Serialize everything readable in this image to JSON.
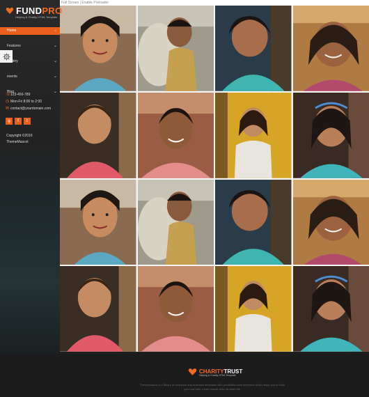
{
  "breadcrumb": "Full Screen | Enable Preloader",
  "brand": {
    "name_a": "FUND",
    "name_b": "PRO",
    "tagline": "Helping & Charity HTML Template"
  },
  "nav": [
    {
      "label": "Home",
      "has_sub": true
    },
    {
      "label": "Features",
      "has_sub": true
    },
    {
      "label": "Gallery",
      "has_sub": true
    },
    {
      "label": "events",
      "has_sub": true
    },
    {
      "label": "Blog",
      "has_sub": true
    }
  ],
  "contact": {
    "phone": "123-456-789",
    "hours": "Mon-Fri 8:00 to 2:00",
    "email": "contact@yourdomain.com"
  },
  "copyright": {
    "line1": "Copyright ©2016",
    "line2": "ThemeMascot"
  },
  "footer": {
    "brand_a": "CHARITY",
    "brand_b": "TRUST",
    "tagline": "Helping & Charity HTML Template",
    "text": "ThemeMascot is a library of corporate and business templates with predefined web elements which helps you to build your own site. Lorem ipsum dolor sit amet elit."
  },
  "colors": {
    "accent": "#e95f1b",
    "sidebar": "#232323",
    "footer": "#1c1c1c"
  },
  "gallery": [
    {
      "name": "gallery-photo-girl-smiling"
    },
    {
      "name": "gallery-photo-boy-with-bag"
    },
    {
      "name": "gallery-photo-child-teal-shirt"
    },
    {
      "name": "gallery-photo-girl-pink-top"
    },
    {
      "name": "gallery-photo-boy-red-shirt"
    },
    {
      "name": "gallery-photo-girl-pink-scarf"
    },
    {
      "name": "gallery-photo-girl-yellow-wall"
    },
    {
      "name": "gallery-photo-girl-headband"
    },
    {
      "name": "gallery-photo-girl-smiling"
    },
    {
      "name": "gallery-photo-boy-with-bag"
    },
    {
      "name": "gallery-photo-child-teal-shirt"
    },
    {
      "name": "gallery-photo-girl-pink-top"
    },
    {
      "name": "gallery-photo-boy-red-shirt"
    },
    {
      "name": "gallery-photo-girl-pink-scarf"
    },
    {
      "name": "gallery-photo-girl-yellow-wall"
    },
    {
      "name": "gallery-photo-girl-headband"
    }
  ]
}
